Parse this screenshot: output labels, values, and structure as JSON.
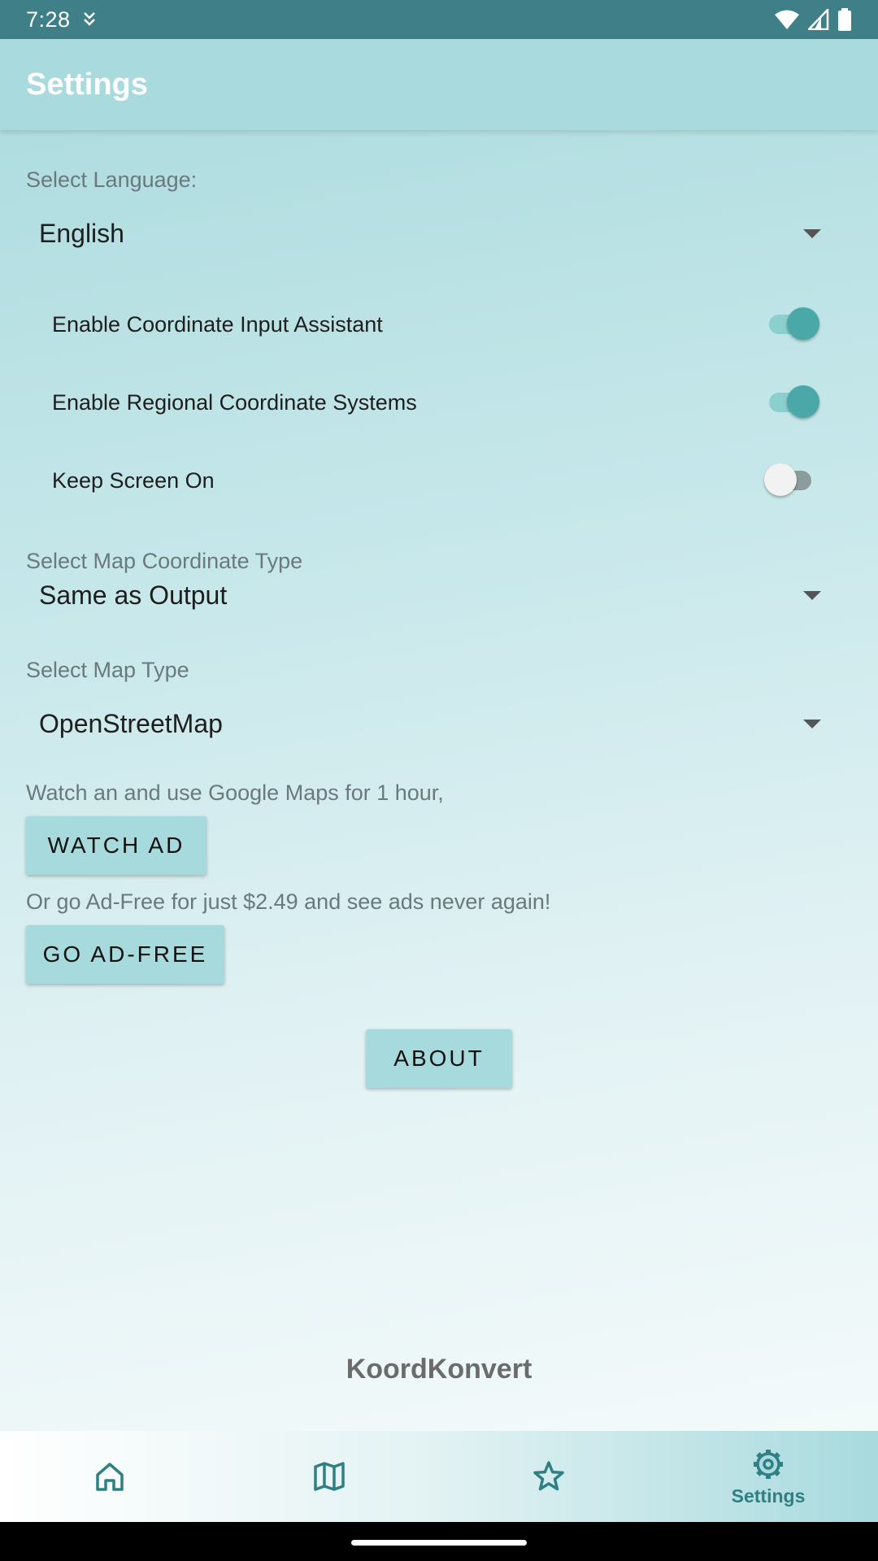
{
  "status_bar": {
    "time": "7:28"
  },
  "app_bar": {
    "title": "Settings"
  },
  "language": {
    "label": "Select Language:",
    "value": "English"
  },
  "switches": [
    {
      "label": "Enable Coordinate Input Assistant",
      "on": true
    },
    {
      "label": "Enable Regional Coordinate Systems",
      "on": true
    },
    {
      "label": "Keep Screen On",
      "on": false
    }
  ],
  "map_coord": {
    "label": "Select Map Coordinate Type",
    "value": "Same as Output"
  },
  "map_type": {
    "label": "Select Map Type",
    "value": "OpenStreetMap"
  },
  "ads": {
    "watch_text": "Watch an and use Google Maps for 1 hour,",
    "watch_button": "WATCH AD",
    "adfree_text": "Or go Ad-Free for just $2.49 and see ads never again!",
    "adfree_button": "GO AD-FREE"
  },
  "about_button": "ABOUT",
  "brand": "KoordKonvert",
  "bottom_nav": {
    "items": [
      {
        "icon": "home-icon"
      },
      {
        "icon": "map-icon"
      },
      {
        "icon": "star-icon"
      },
      {
        "icon": "gear-icon",
        "label": "Settings",
        "selected": true
      }
    ]
  },
  "colors": {
    "accent": "#4aa9a8",
    "app_bar": "#a8dade",
    "status_bar": "#3f7f87",
    "button": "#a7dadc"
  }
}
